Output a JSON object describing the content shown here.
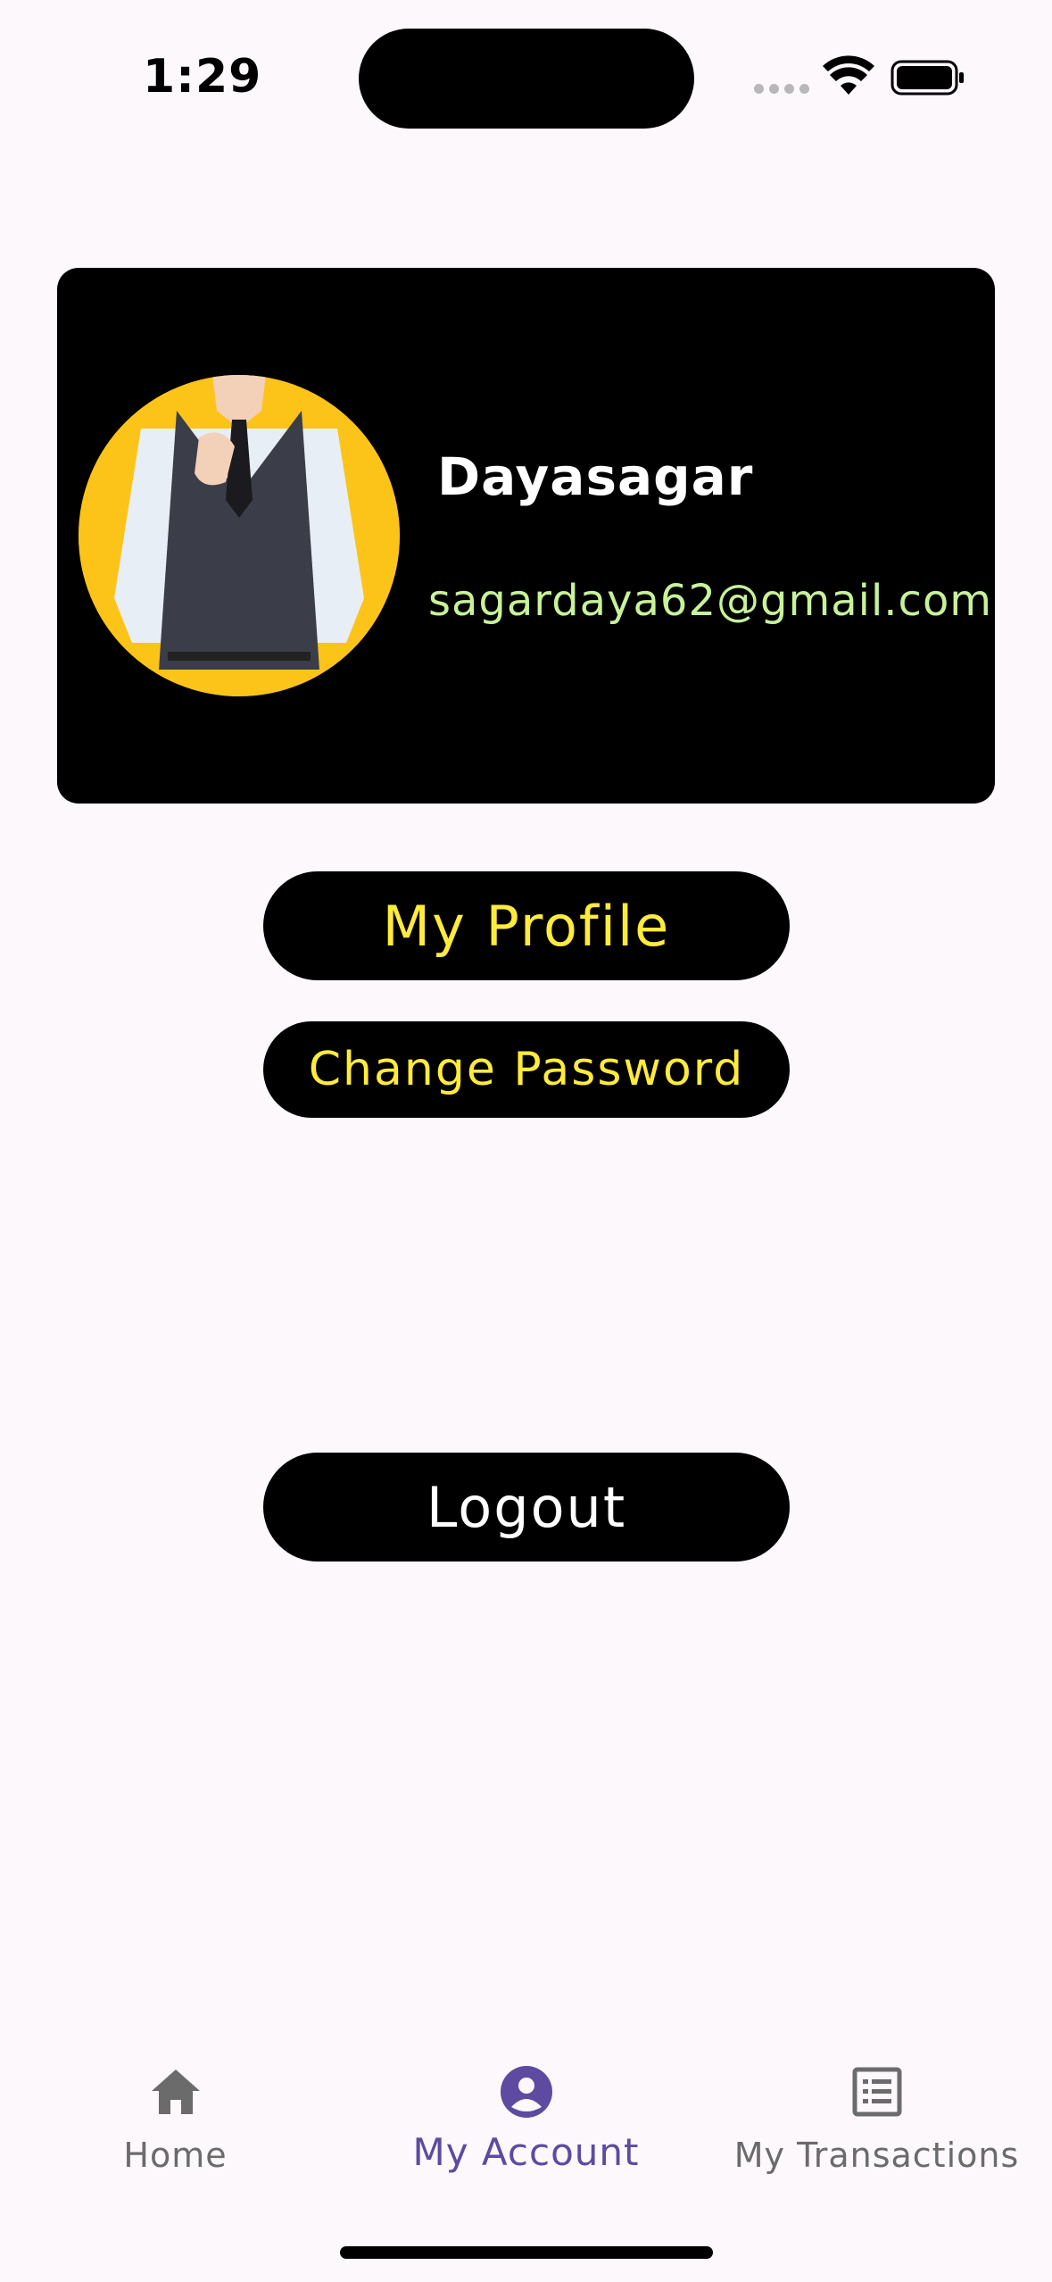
{
  "status_bar": {
    "time": "1:29"
  },
  "profile": {
    "name": "Dayasagar",
    "email": "sagardaya62@gmail.com",
    "avatar_bg": "#fcc419"
  },
  "actions": {
    "my_profile_label": "My Profile",
    "change_password_label": "Change Password",
    "logout_label": "Logout"
  },
  "bottom_nav": {
    "items": [
      {
        "label": "Home",
        "icon": "home-icon",
        "active": false
      },
      {
        "label": "My Account",
        "icon": "account-icon",
        "active": true
      },
      {
        "label": "My Transactions",
        "icon": "list-icon",
        "active": false
      }
    ]
  },
  "colors": {
    "background": "#fdf8fc",
    "card": "#000000",
    "button_text_yellow": "#ffeb3b",
    "email_green": "#c8f29a",
    "nav_active": "#5e4aa0",
    "nav_inactive": "#6b6b6b"
  }
}
